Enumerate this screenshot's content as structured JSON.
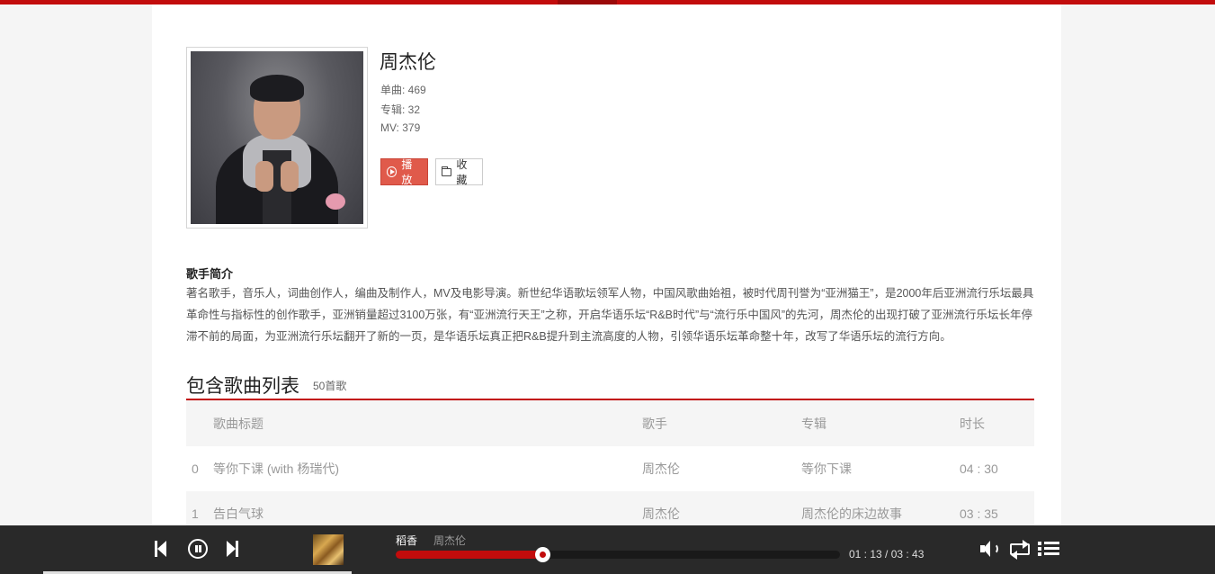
{
  "colors": {
    "accent": "#c20c0c",
    "play_button": "#e05a4b",
    "player_bg": "#292929"
  },
  "artist": {
    "name": "周杰伦",
    "stats": [
      "单曲: 469",
      "专辑: 32",
      "MV: 379"
    ],
    "buttons": {
      "play": "播放",
      "favorite": "收藏"
    },
    "icons": {
      "play": "play-circle-icon",
      "favorite": "folder-icon"
    }
  },
  "bio": {
    "title": "歌手简介",
    "text": "著名歌手，音乐人，词曲创作人，编曲及制作人，MV及电影导演。新世纪华语歌坛领军人物，中国风歌曲始祖，被时代周刊誉为“亚洲猫王”，是2000年后亚洲流行乐坛最具革命性与指标性的创作歌手，亚洲销量超过3100万张，有“亚洲流行天王”之称，开启华语乐坛“R&B时代”与“流行乐中国风”的先河，周杰伦的出现打破了亚洲流行乐坛长年停滞不前的局面，为亚洲流行乐坛翻开了新的一页，是华语乐坛真正把R&B提升到主流高度的人物，引领华语乐坛革命整十年，改写了华语乐坛的流行方向。"
  },
  "songs": {
    "title": "包含歌曲列表",
    "count": "50首歌",
    "columns": {
      "title": "歌曲标题",
      "singer": "歌手",
      "album": "专辑",
      "duration": "时长"
    },
    "rows": [
      {
        "index": "0",
        "title": "等你下课 (with 杨瑞代)",
        "singer": "周杰伦",
        "album": "等你下课",
        "duration": "04 : 30"
      },
      {
        "index": "1",
        "title": "告白气球",
        "singer": "周杰伦",
        "album": "周杰伦的床边故事",
        "duration": "03 : 35"
      }
    ]
  },
  "player": {
    "song": "稻香",
    "artist": "周杰伦",
    "time": "01 : 13 / 03 : 43",
    "progress": 0.33,
    "icons": [
      "prev-icon",
      "pause-icon",
      "next-icon",
      "volume-icon",
      "loop-icon",
      "playlist-icon"
    ]
  }
}
